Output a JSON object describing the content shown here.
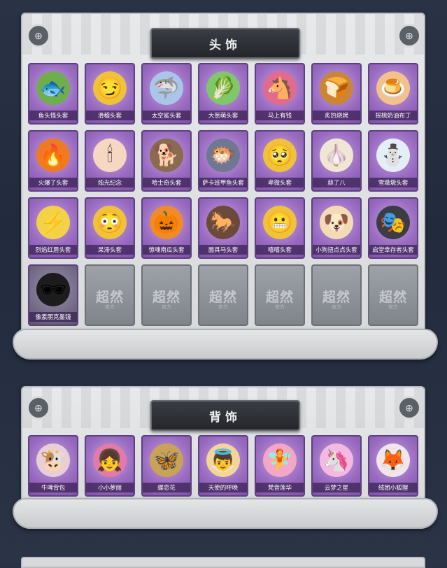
{
  "sections": {
    "headwear": {
      "title": "头饰",
      "items": [
        {
          "label": "鱼头怪头套",
          "icon": "fish-head",
          "color": "#6fae4d",
          "glyph": "🐟"
        },
        {
          "label": "滑稽头套",
          "icon": "funny-face",
          "color": "#f0c23a",
          "glyph": "😏"
        },
        {
          "label": "太空鲨头套",
          "icon": "shark",
          "color": "#a9c6ea",
          "glyph": "🦈"
        },
        {
          "label": "大葱萌头套",
          "icon": "leek",
          "color": "#7fc76a",
          "glyph": "🥬"
        },
        {
          "label": "马上有钱",
          "icon": "horse-money",
          "color": "#e26a8f",
          "glyph": "🐴"
        },
        {
          "label": "炙热烧烤",
          "icon": "toast",
          "color": "#c9863a",
          "glyph": "🍞"
        },
        {
          "label": "摇桃奶油布丁",
          "icon": "pudding",
          "color": "#f3c28a",
          "glyph": "🍮"
        },
        {
          "label": "火爆了头套",
          "icon": "fire",
          "color": "#f07a22",
          "glyph": "🔥"
        },
        {
          "label": "烛光纪念",
          "icon": "candle",
          "color": "#f6d7c1",
          "glyph": "🕯"
        },
        {
          "label": "哈士奇头套",
          "icon": "dog",
          "color": "#8a6b4f",
          "glyph": "🐕"
        },
        {
          "label": "萨卡班甲鱼头套",
          "icon": "fish-blob",
          "color": "#6e7890",
          "glyph": "🐡"
        },
        {
          "label": "卑微头套",
          "icon": "humble-face",
          "color": "#f0c23a",
          "glyph": "🥺"
        },
        {
          "label": "蒜了八",
          "icon": "garlic",
          "color": "#efe6d3",
          "glyph": "🧄"
        },
        {
          "label": "雪墩墩头套",
          "icon": "snowman",
          "color": "#e3eef6",
          "glyph": "⛄"
        },
        {
          "label": "烈焰红唇头套",
          "icon": "pikachu",
          "color": "#f4d247",
          "glyph": "⚡"
        },
        {
          "label": "呆滞头套",
          "icon": "dazed-face",
          "color": "#f0c23a",
          "glyph": "😳"
        },
        {
          "label": "惊魂南瓜头套",
          "icon": "pumpkin",
          "color": "#f08a2a",
          "glyph": "🎃"
        },
        {
          "label": "面具马头套",
          "icon": "horse-mask",
          "color": "#6b4a3a",
          "glyph": "🐎"
        },
        {
          "label": "嘻嘻头套",
          "icon": "grin-face",
          "color": "#f0c23a",
          "glyph": "😬"
        },
        {
          "label": "小狗扭点点头套",
          "icon": "puppy",
          "color": "#f3dcb5",
          "glyph": "🐶"
        },
        {
          "label": "启堂幸存者头套",
          "icon": "gas-mask",
          "color": "#3a3d44",
          "glyph": "🎭"
        },
        {
          "label": "像素朋克墨镜",
          "icon": "pixel-sunglasses",
          "color": "#1c1c1c",
          "glyph": "🕶"
        }
      ],
      "empty_slots": [
        {
          "logo": "超然",
          "sub": "官方"
        },
        {
          "logo": "超然",
          "sub": "官方"
        },
        {
          "logo": "超然",
          "sub": "官方"
        },
        {
          "logo": "超然",
          "sub": "官方"
        },
        {
          "logo": "超然",
          "sub": "官方"
        },
        {
          "logo": "超然",
          "sub": "官方"
        }
      ]
    },
    "backwear": {
      "title": "背饰",
      "items": [
        {
          "label": "牛啤背包",
          "icon": "cow-backpack",
          "color": "#e8cfd6",
          "glyph": "🐮"
        },
        {
          "label": "小小萝丽",
          "icon": "doll-girl",
          "color": "#e37aa8",
          "glyph": "👧"
        },
        {
          "label": "蝶恋花",
          "icon": "butterfly-flower",
          "color": "#c9a255",
          "glyph": "🦋"
        },
        {
          "label": "天使的呼唤",
          "icon": "angel",
          "color": "#f3d59a",
          "glyph": "👼"
        },
        {
          "label": "梵音莲华",
          "icon": "lotus-girl",
          "color": "#f2a6c8",
          "glyph": "🧚"
        },
        {
          "label": "云梦之星",
          "icon": "unicorn-cloud",
          "color": "#f4b9e0",
          "glyph": "🦄"
        },
        {
          "label": "绒团小狐狸",
          "icon": "fox",
          "color": "#f1e4ea",
          "glyph": "🦊"
        }
      ]
    }
  },
  "corner_icon": "crosshair-ornament-icon"
}
